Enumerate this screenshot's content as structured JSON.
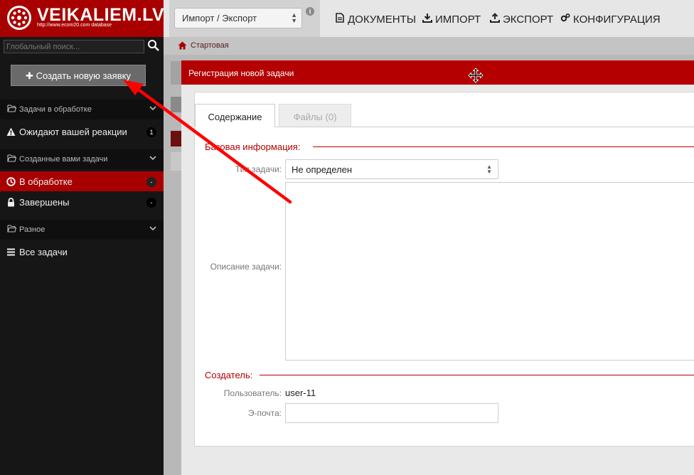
{
  "logo": {
    "name": "VEIKALIEM.LV",
    "subtitle": "http://www.ecom20.com database"
  },
  "header": {
    "selector": {
      "value": "Импорт / Экспорт"
    },
    "info_glyph": "i",
    "nav": [
      {
        "label": "ДОКУМЕНТЫ",
        "icon": "document-icon"
      },
      {
        "label": "ИМПОРТ",
        "icon": "download-icon"
      },
      {
        "label": "ЭКСПОРТ",
        "icon": "upload-icon"
      },
      {
        "label": "КОНФИГУРАЦИЯ",
        "icon": "gears-icon"
      }
    ]
  },
  "sidebar": {
    "search_placeholder": "Глобальный поиск...",
    "new_button": "Создать новую заявку",
    "new_button_glyph": "✚",
    "sections": [
      {
        "title": "Задачи в обработке"
      },
      {
        "title": "Созданные вами задачи"
      },
      {
        "title": "Разное"
      }
    ],
    "items": [
      {
        "label": "Ожидают вашей реакции",
        "badge": "1",
        "icon": "warning-icon"
      },
      {
        "label": "В обработке",
        "badge": "-",
        "icon": "clock-icon",
        "active": true
      },
      {
        "label": "Завершены",
        "badge": "-",
        "icon": "lock-icon"
      },
      {
        "label": "Все задачи",
        "icon": "list-icon"
      }
    ]
  },
  "breadcrumb": {
    "home": "Стартовая"
  },
  "modal": {
    "title": "Регистрация новой задачи",
    "tabs": [
      {
        "label": "Содержание",
        "active": true
      },
      {
        "label": "Файлы (0)",
        "active": false
      }
    ],
    "basic_section": "Базовая информация:",
    "type_label": "Тип задачи:",
    "type_value": "Не определен",
    "description_label": "Описание задачи:",
    "creator_section": "Создатель:",
    "user_label": "Пользователь:",
    "user_value": "user-11",
    "email_label": "Э-почта:",
    "email_value": ""
  },
  "colors": {
    "brand": "#a80000",
    "modal_header": "#b40000",
    "annotation_arrow": "#ff0000"
  }
}
